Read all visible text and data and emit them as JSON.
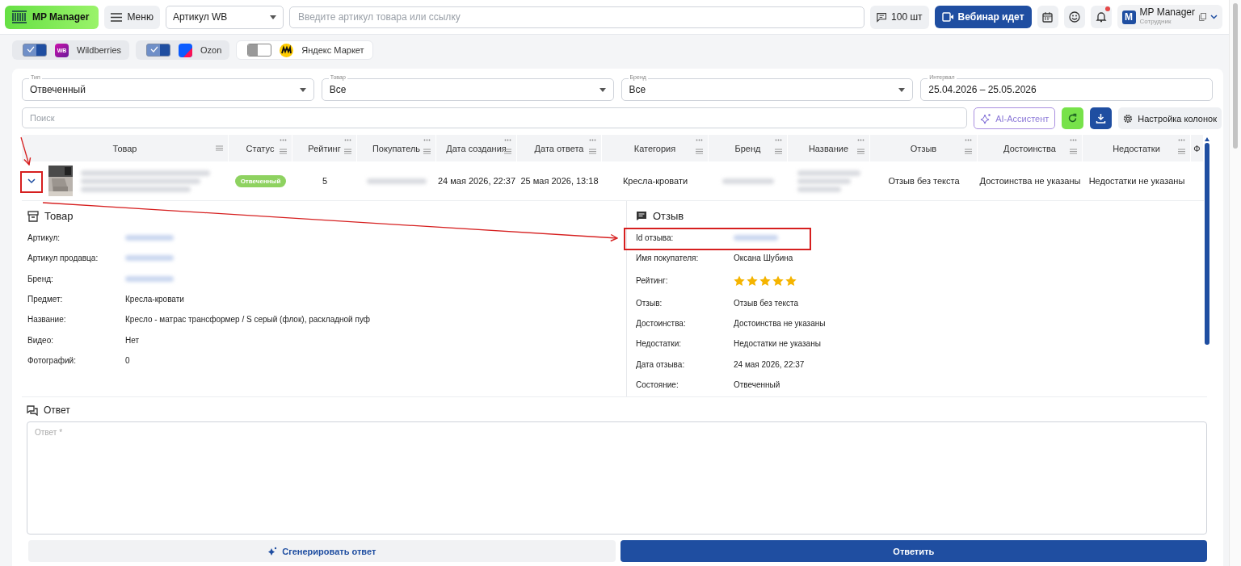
{
  "header": {
    "logo": "MP Manager",
    "menu": "Меню",
    "search_type": "Артикул WB",
    "search": {
      "placeholder": "Введите артикул товара или ссылку"
    },
    "counter": "100 шт",
    "webinar": "Вебинар идет",
    "user": {
      "initial": "M",
      "name": "MP Manager",
      "role": "Сотрудник"
    }
  },
  "marketplaces": [
    {
      "kind": "wb",
      "name": "Wildberries",
      "logo_text": "WB",
      "on": true
    },
    {
      "kind": "ozon",
      "name": "Ozon",
      "on": true
    },
    {
      "kind": "yandex",
      "name": "Яндекс Маркет",
      "on": false
    }
  ],
  "filters": [
    {
      "kind": "select",
      "label": "Тип",
      "value": "Отвеченный"
    },
    {
      "kind": "select",
      "label": "Товар",
      "value": "Все"
    },
    {
      "kind": "select",
      "label": "Бренд",
      "value": "Все"
    },
    {
      "kind": "range",
      "label": "Интервал",
      "value": "25.04.2026 – 25.05.2026"
    }
  ],
  "toolbar": {
    "search": {
      "placeholder": "Поиск"
    },
    "ai": "AI-Ассистент",
    "columns": "Настройка колонок"
  },
  "table": {
    "columns": [
      "Товар",
      "Статус",
      "Рейтинг",
      "Покупатель",
      "Дата создания",
      "Дата ответа",
      "Категория",
      "Бренд",
      "Название",
      "Отзыв",
      "Достоинства",
      "Недостатки",
      "Ф"
    ],
    "rows": [
      {
        "expanded": true,
        "status": "Отвеченный",
        "rating": "5",
        "created": "24 мая 2026, 22:37",
        "answered": "25 мая 2026, 13:18",
        "category": "Кресла-кровати",
        "review": "Отзыв без текста",
        "pros": "Достоинства не указаны",
        "cons": "Недостатки не указаны"
      }
    ]
  },
  "details": {
    "product": {
      "title": "Товар",
      "fields": [
        {
          "kind": "blurred",
          "label": "Артикул:"
        },
        {
          "kind": "blurred",
          "label": "Артикул продавца:"
        },
        {
          "kind": "blurred",
          "label": "Бренд:"
        },
        {
          "kind": "text",
          "label": "Предмет:",
          "value": "Кресла-кровати"
        },
        {
          "kind": "text",
          "label": "Название:",
          "value": "Кресло - матрас трансформер / S серый (флок), раскладной пуф"
        },
        {
          "kind": "text",
          "label": "Видео:",
          "value": "Нет"
        },
        {
          "kind": "text",
          "label": "Фотографий:",
          "value": "0"
        }
      ]
    },
    "review": {
      "title": "Отзыв",
      "fields": [
        {
          "kind": "blurred",
          "label": "Id отзыва:"
        },
        {
          "kind": "text",
          "label": "Имя покупателя:",
          "value": "Оксана Шубина"
        },
        {
          "kind": "stars",
          "label": "Рейтинг:",
          "stars": 5
        },
        {
          "kind": "text",
          "label": "Отзыв:",
          "value": "Отзыв без текста"
        },
        {
          "kind": "text",
          "label": "Достоинства:",
          "value": "Достоинства не указаны"
        },
        {
          "kind": "text",
          "label": "Недостатки:",
          "value": "Недостатки не указаны"
        },
        {
          "kind": "text",
          "label": "Дата отзыва:",
          "value": "24 мая 2026, 22:37"
        },
        {
          "kind": "text",
          "label": "Состояние:",
          "value": "Отвеченный"
        }
      ]
    }
  },
  "answer": {
    "title": "Ответ",
    "placeholder": "Ответ *",
    "generate": "Сгенерировать ответ",
    "submit": "Ответить"
  }
}
